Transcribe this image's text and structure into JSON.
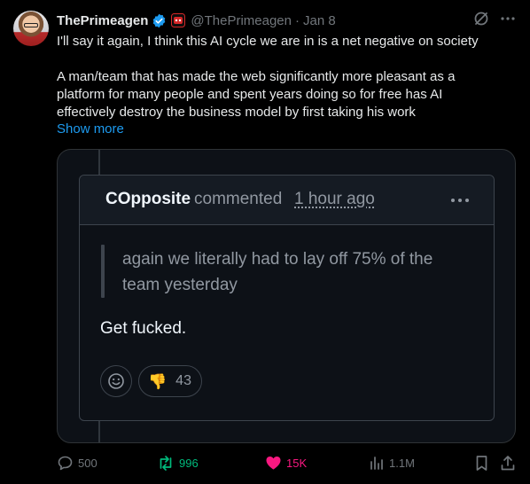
{
  "author": {
    "name": "ThePrimeagen",
    "handle": "@ThePrimeagen",
    "separator": "·",
    "date": "Jan 8",
    "avatar_icon": "avatar-photo",
    "verified_icon": "verified-badge-icon",
    "affiliate_icon": "affiliate-badge-icon"
  },
  "tweet": {
    "line1": "I'll say it again, I think this AI cycle we are in is a net negative on society",
    "line2": "A man/team that has made the web significantly more pleasant as a",
    "line3": "platform for many people and spent years doing so for free has AI",
    "line4": "effectively destroy the business model by first taking his work",
    "show_more": "Show more"
  },
  "media": {
    "comment_author": "COpposite",
    "comment_action": "commented",
    "comment_time": "1 hour ago",
    "quote_line1": "again we literally had to lay off 75% of the",
    "quote_line2": "team yesterday",
    "reply": "Get fucked.",
    "reaction_emoji": "👎",
    "reaction_count": "43"
  },
  "actions": {
    "replies": "500",
    "reposts": "996",
    "likes": "15K",
    "views": "1.1M"
  },
  "colors": {
    "background": "#000000",
    "text": "#e7e9ea",
    "muted": "#71767b",
    "link": "#1d9bf0",
    "repost": "#00ba7c",
    "like": "#f91880",
    "verified": "#1d9bf0"
  }
}
